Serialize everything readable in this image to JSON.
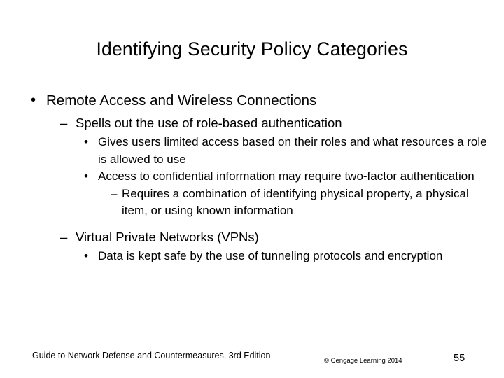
{
  "slide": {
    "title": "Identifying Security Policy Categories",
    "bullets": {
      "l1_remote_access": "Remote Access and Wireless Connections",
      "l2_spells_out": "Spells out the use of role-based authentication",
      "l3_gives_users": "Gives users limited access based on their roles and what resources a role is allowed to use",
      "l3_access_conf": "Access to confidential information may require two-factor authentication",
      "l4_requires": "Requires a combination of identifying physical property, a physical item, or using known information",
      "l2_vpn": "Virtual Private Networks (VPNs)",
      "l3_data_kept_safe": "Data is kept safe by the use of tunneling protocols and encryption"
    },
    "markers": {
      "dot": "•",
      "dash": "–"
    },
    "footer": {
      "source": "Guide to Network Defense and Countermeasures, 3rd Edition",
      "copyright": "© Cengage Learning  2014",
      "page_number": "55"
    }
  }
}
